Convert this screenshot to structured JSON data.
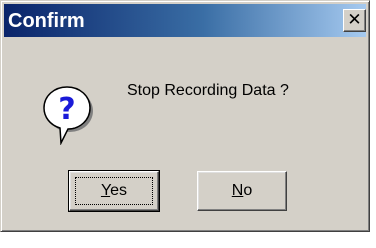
{
  "dialog": {
    "title": "Confirm",
    "close_glyph": "✕",
    "message": "Stop Recording Data ?",
    "icon": "question-icon"
  },
  "buttons": {
    "yes": {
      "mnemonic": "Y",
      "rest": "es",
      "default": true
    },
    "no": {
      "mnemonic": "N",
      "rest": "o",
      "default": false
    }
  },
  "colors": {
    "title_start": "#0a246a",
    "title_end": "#a6caf0",
    "face": "#d4d0c8",
    "icon_bubble": "#ffffff",
    "icon_mark": "#1a1ad8"
  }
}
